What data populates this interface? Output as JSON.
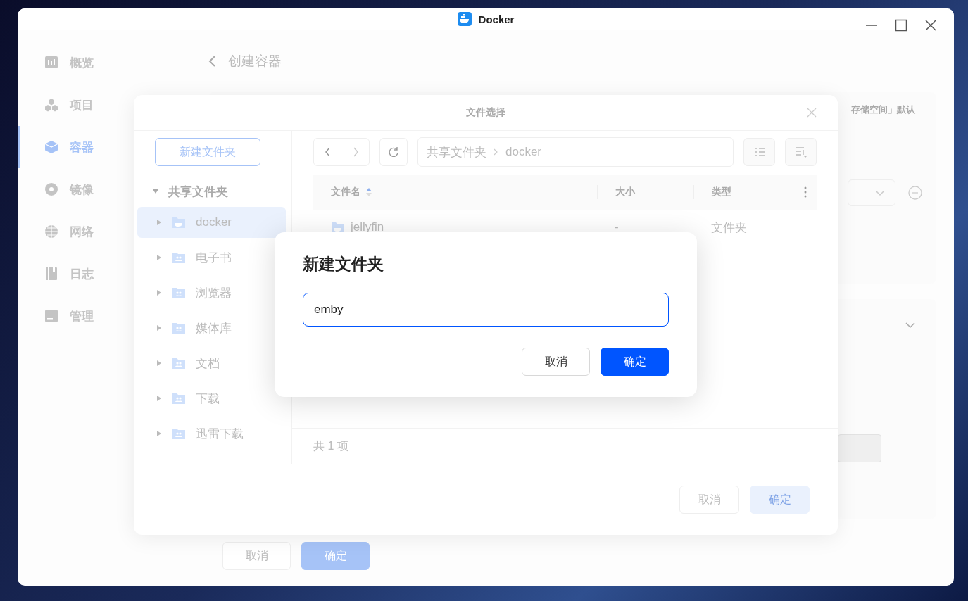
{
  "window": {
    "title": "Docker"
  },
  "sidebar": {
    "items": [
      {
        "label": "概览",
        "kind": "overview",
        "selected": false
      },
      {
        "label": "项目",
        "kind": "project",
        "selected": false
      },
      {
        "label": "容器",
        "kind": "container",
        "selected": true
      },
      {
        "label": "镜像",
        "kind": "image",
        "selected": false
      },
      {
        "label": "网络",
        "kind": "network",
        "selected": false
      },
      {
        "label": "日志",
        "kind": "log",
        "selected": false
      },
      {
        "label": "管理",
        "kind": "manage",
        "selected": false
      }
    ]
  },
  "page": {
    "title": "创建容器",
    "note": "存储空间」默认",
    "buttons": [
      {
        "label": "取消",
        "kind": "default"
      },
      {
        "label": "确定",
        "kind": "primary"
      }
    ]
  },
  "file_dialog": {
    "title": "文件选择",
    "new_folder_button": "新建文件夹",
    "tree": {
      "label": "共享文件夹",
      "expanded": true,
      "children": [
        {
          "label": "docker",
          "kind": "docker",
          "expanded": false,
          "selected": true
        },
        {
          "label": "电子书",
          "kind": "shared",
          "expanded": false,
          "selected": false
        },
        {
          "label": "浏览器",
          "kind": "shared",
          "expanded": false,
          "selected": false
        },
        {
          "label": "媒体库",
          "kind": "shared",
          "expanded": false,
          "selected": false
        },
        {
          "label": "文档",
          "kind": "shared",
          "expanded": false,
          "selected": false
        },
        {
          "label": "下载",
          "kind": "shared",
          "expanded": false,
          "selected": false
        },
        {
          "label": "迅雷下载",
          "kind": "shared",
          "expanded": false,
          "selected": false
        }
      ]
    },
    "path": [
      "共享文件夹",
      "docker"
    ],
    "columns": [
      {
        "label": "文件名",
        "sorted": true
      },
      {
        "label": "大小",
        "sorted": false
      },
      {
        "label": "类型",
        "sorted": false
      }
    ],
    "rows": [
      {
        "name": "jellyfin",
        "size": "-",
        "type": "文件夹",
        "kind": "docker"
      }
    ],
    "count": "共 1 项",
    "buttons": [
      {
        "label": "取消",
        "kind": "default"
      },
      {
        "label": "确定",
        "kind": "disabled"
      }
    ]
  },
  "new_folder_dialog": {
    "title": "新建文件夹",
    "value": "emby",
    "buttons": [
      {
        "label": "取消",
        "kind": "default"
      },
      {
        "label": "确定",
        "kind": "primary"
      }
    ]
  }
}
